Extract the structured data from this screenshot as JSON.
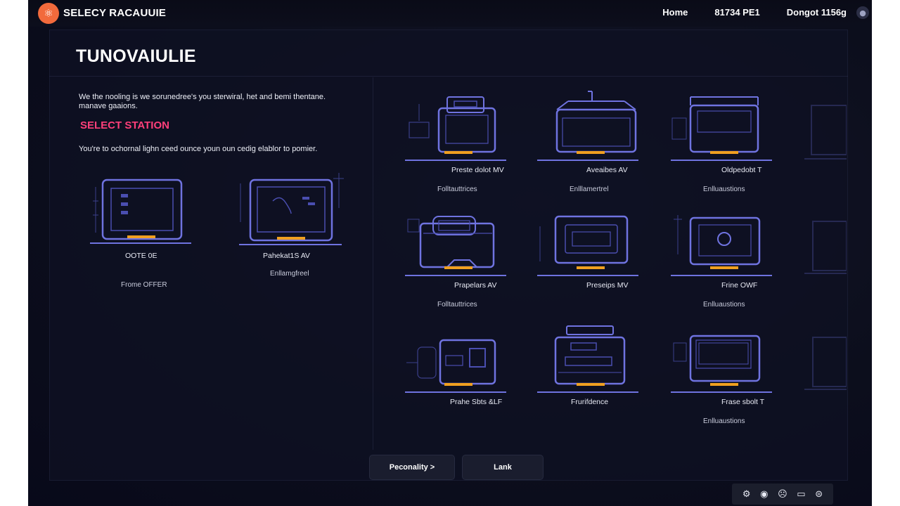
{
  "header": {
    "brand": "SELECY RACAUUIE",
    "nav": [
      "Home",
      "81734 PE1",
      "Dongot 1156g"
    ]
  },
  "page": {
    "title": "TUNOVAIULIE",
    "intro": "We the nooling is we sorunedree's you sterwiral, het and bemi thentane. manave gaaions.",
    "section_title": "SELECT STATION",
    "instruction": "You're to ochornal lighn ceed ounce youn oun cedig elablor to pomier."
  },
  "featured_stations": [
    {
      "name": "OOTE 0E",
      "tag": "Frome OFFER"
    },
    {
      "name": "Pahekat1S AV",
      "tag": "Enllamgfreel"
    }
  ],
  "stations": [
    {
      "name": "Preste dolot MV",
      "tag": "Folltauttrices"
    },
    {
      "name": "Aveaibes AV",
      "tag": "Enlllamertrel"
    },
    {
      "name": "Oldpedobt T",
      "tag": "Enlluaustions"
    },
    {
      "name": "Prapelars AV",
      "tag": "Folltauttrices"
    },
    {
      "name": "Preseips MV",
      "tag": ""
    },
    {
      "name": "Frine OWF",
      "tag": "Enlluaustions"
    },
    {
      "name": "Prahe Sbts &LF",
      "tag": ""
    },
    {
      "name": "Frurifdence",
      "tag": ""
    },
    {
      "name": "Frase sbolt T",
      "tag": "Enlluaustions"
    }
  ],
  "buttons": {
    "primary": "Peconality >",
    "secondary": "Lank"
  },
  "colors": {
    "accent": "#ff3f7a",
    "station_line": "#6f73e0",
    "station_base": "#f0a020",
    "logo": "#f26a3c"
  }
}
